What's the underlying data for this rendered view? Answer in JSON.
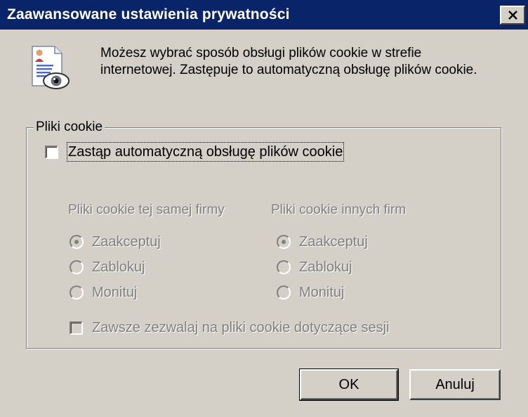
{
  "window": {
    "title": "Zaawansowane ustawienia prywatności",
    "close_label": "×"
  },
  "intro": {
    "text": "Możesz wybrać sposób obsługi plików cookie w strefie internetowej. Zastępuje to automatyczną obsługę plików cookie."
  },
  "group": {
    "legend": "Pliki cookie",
    "override_label": "Zastąp automatyczną obsługę plików cookie",
    "override_checked": false,
    "first_party": {
      "heading": "Pliki cookie tej samej firmy",
      "options": [
        "Zaakceptuj",
        "Zablokuj",
        "Monituj"
      ],
      "selected": "Zaakceptuj"
    },
    "third_party": {
      "heading": "Pliki cookie innych firm",
      "options": [
        "Zaakceptuj",
        "Zablokuj",
        "Monituj"
      ],
      "selected": "Zaakceptuj"
    },
    "session_label": "Zawsze zezwalaj na pliki cookie dotyczące sesji",
    "session_checked": false
  },
  "buttons": {
    "ok": "OK",
    "cancel": "Anuluj"
  },
  "colors": {
    "titlebar": "#0a246a",
    "face": "#d4d0c8",
    "disabled_text": "#808080"
  },
  "icons": {
    "title_close": "close-icon",
    "privacy": "privacy-document-eye-icon"
  }
}
